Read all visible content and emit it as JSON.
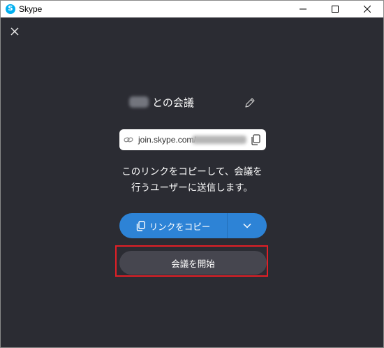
{
  "window": {
    "app_title": "Skype",
    "app_icon_letter": "S"
  },
  "meeting": {
    "title_suffix": "との会議"
  },
  "link": {
    "prefix": "join.skype.com/"
  },
  "instructions": {
    "line1": "このリンクをコピーして、会議を",
    "line2": "行うユーザーに送信します。"
  },
  "buttons": {
    "copy_label": "リンクをコピー",
    "start_label": "会議を開始"
  },
  "colors": {
    "background": "#2b2c33",
    "accent": "#2d83d6",
    "start_button": "#46464f",
    "highlight": "#e21f26",
    "skype_blue": "#00aff0"
  },
  "icons": {
    "app": "skype-icon",
    "close": "close-icon",
    "edit": "pencil-icon",
    "link": "link-icon",
    "copy": "copy-icon",
    "dropdown": "chevron-down-icon",
    "minimize": "minimize-icon",
    "maximize": "maximize-icon",
    "window_close": "window-close-icon"
  }
}
